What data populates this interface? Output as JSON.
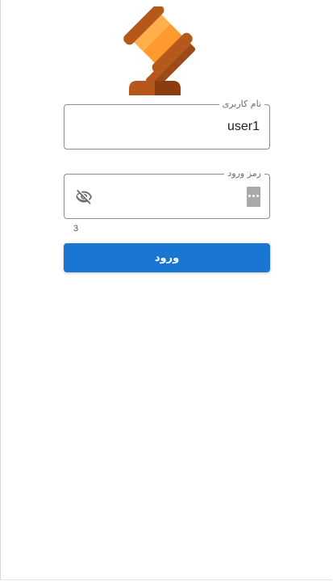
{
  "login": {
    "username": {
      "label": "نام کاربری",
      "value": "user1"
    },
    "password": {
      "label": "رمز ورود",
      "value": ""
    },
    "counter": "3",
    "submit_label": "ورود"
  },
  "icons": {
    "logo": "gavel-icon",
    "toggle_visibility": "eye-off-icon",
    "password_manager": "more-dots-icon"
  },
  "colors": {
    "primary": "#1976d2",
    "gavel_head": "#ff9a2e",
    "gavel_dark": "#b5581c"
  }
}
